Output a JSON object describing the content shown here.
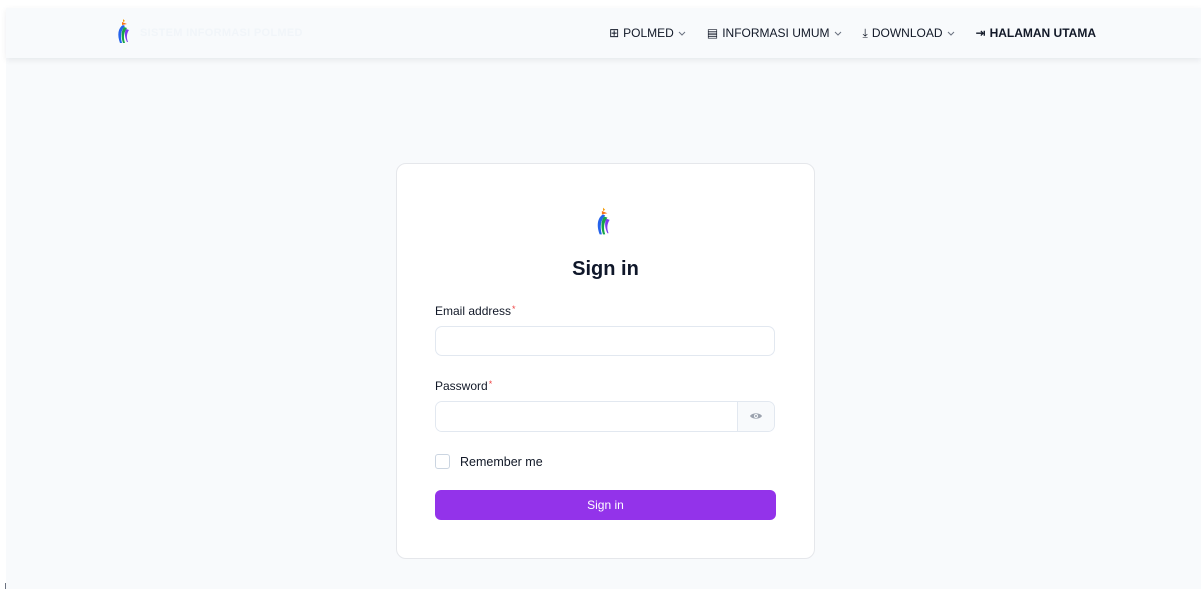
{
  "brand": {
    "logo_icon": "bird-of-paradise-logo-icon",
    "name": "SISTEM INFORMASI POLMED"
  },
  "nav": {
    "items": [
      {
        "icon": "grid-icon",
        "glyph": "⊞",
        "label": "POLMED",
        "dropdown": true
      },
      {
        "icon": "newspaper-icon",
        "glyph": "▤",
        "label": "INFORMASI UMUM",
        "dropdown": true
      },
      {
        "icon": "download-icon",
        "glyph": "⤓",
        "label": "DOWNLOAD",
        "dropdown": true
      },
      {
        "icon": "login-icon",
        "glyph": "⇥",
        "label": "HALAMAN UTAMA",
        "dropdown": false
      }
    ],
    "chevron": "⌄"
  },
  "form": {
    "title": "Sign in",
    "email_label": "Email address",
    "email_value": "",
    "password_label": "Password",
    "password_value": "",
    "required_mark": "*",
    "remember_label": "Remember me",
    "remember_checked": false,
    "submit_label": "Sign in"
  },
  "colors": {
    "accent": "#9333ea",
    "required": "#ef4444",
    "background": "#f8fafc"
  }
}
